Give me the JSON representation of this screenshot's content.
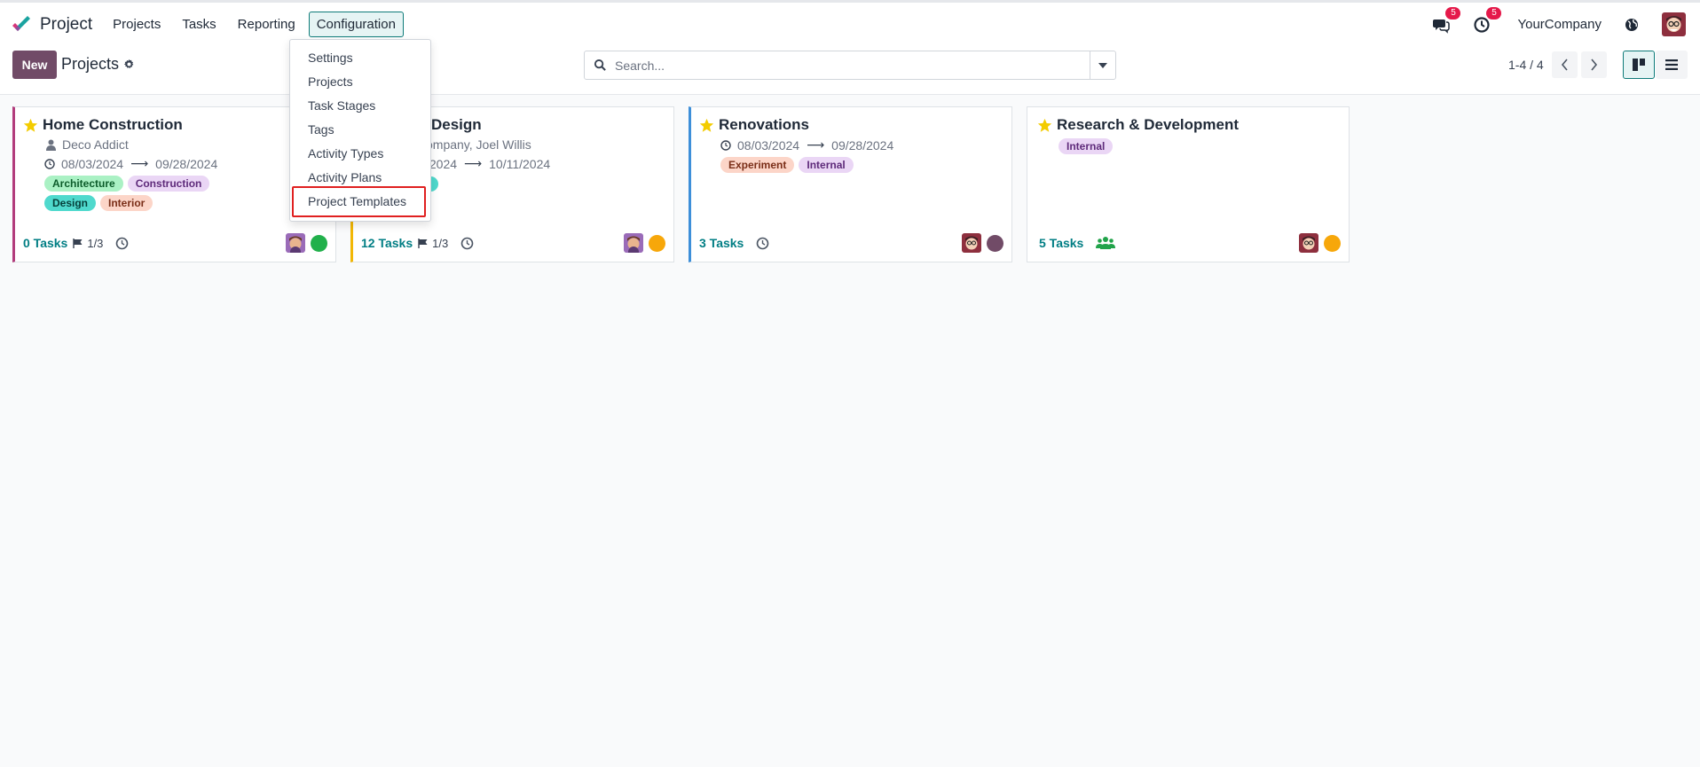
{
  "app": {
    "name": "Project",
    "brand_color": "#714b67",
    "accent_color": "#017e84"
  },
  "nav": {
    "items": [
      {
        "label": "Projects",
        "active": false
      },
      {
        "label": "Tasks",
        "active": false
      },
      {
        "label": "Reporting",
        "active": false
      },
      {
        "label": "Configuration",
        "active": true
      }
    ],
    "messages_badge": "5",
    "activities_badge": "5",
    "company": "YourCompany"
  },
  "control": {
    "new_label": "New",
    "breadcrumb": "Projects",
    "search_placeholder": "Search...",
    "pager": "1-4 / 4"
  },
  "dropdown": {
    "items": [
      "Settings",
      "Projects",
      "Task Stages",
      "Tags",
      "Activity Types",
      "Activity Plans",
      "Project Templates"
    ],
    "highlighted": "Project Templates"
  },
  "cards": [
    {
      "title": "Home Construction",
      "customer": "Deco Addict",
      "start": "08/03/2024",
      "end": "09/28/2024",
      "tags": [
        "Architecture",
        "Construction",
        "Design",
        "Interior"
      ],
      "tasks": "0 Tasks",
      "milestones": "1/3",
      "status_color": "#21b04b",
      "border_color": "#b23c7c"
    },
    {
      "title": "Design",
      "customer": "ompany, Joel Willis",
      "start": "/2024",
      "end": "10/11/2024",
      "tags": [],
      "tasks": "12 Tasks",
      "milestones": "1/3",
      "status_color": "#f7a70a",
      "border_color": "#f2b705"
    },
    {
      "title": "Renovations",
      "customer": "",
      "start": "08/03/2024",
      "end": "09/28/2024",
      "tags": [
        "Experiment",
        "Internal"
      ],
      "tasks": "3 Tasks",
      "milestones": "",
      "status_color": "#714b67",
      "border_color": "#3d8fd9"
    },
    {
      "title": "Research & Development",
      "customer": "",
      "start": "",
      "end": "",
      "tags": [
        "Internal"
      ],
      "tasks": "5 Tasks",
      "milestones": "",
      "status_color": "#f7a70a",
      "border_color": "#dee2e6"
    }
  ],
  "arrow": "⟶"
}
